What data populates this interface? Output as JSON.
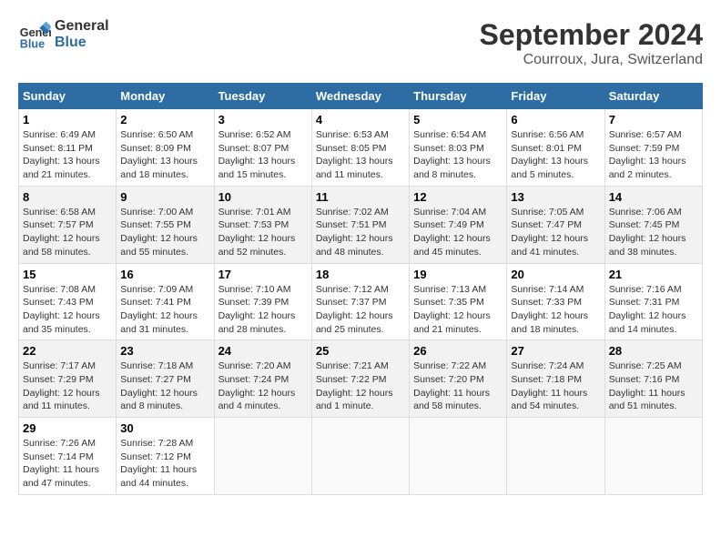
{
  "header": {
    "logo_line1": "General",
    "logo_line2": "Blue",
    "title": "September 2024",
    "subtitle": "Courroux, Jura, Switzerland"
  },
  "days_of_week": [
    "Sunday",
    "Monday",
    "Tuesday",
    "Wednesday",
    "Thursday",
    "Friday",
    "Saturday"
  ],
  "weeks": [
    [
      {
        "day": "1",
        "info": "Sunrise: 6:49 AM\nSunset: 8:11 PM\nDaylight: 13 hours\nand 21 minutes."
      },
      {
        "day": "2",
        "info": "Sunrise: 6:50 AM\nSunset: 8:09 PM\nDaylight: 13 hours\nand 18 minutes."
      },
      {
        "day": "3",
        "info": "Sunrise: 6:52 AM\nSunset: 8:07 PM\nDaylight: 13 hours\nand 15 minutes."
      },
      {
        "day": "4",
        "info": "Sunrise: 6:53 AM\nSunset: 8:05 PM\nDaylight: 13 hours\nand 11 minutes."
      },
      {
        "day": "5",
        "info": "Sunrise: 6:54 AM\nSunset: 8:03 PM\nDaylight: 13 hours\nand 8 minutes."
      },
      {
        "day": "6",
        "info": "Sunrise: 6:56 AM\nSunset: 8:01 PM\nDaylight: 13 hours\nand 5 minutes."
      },
      {
        "day": "7",
        "info": "Sunrise: 6:57 AM\nSunset: 7:59 PM\nDaylight: 13 hours\nand 2 minutes."
      }
    ],
    [
      {
        "day": "8",
        "info": "Sunrise: 6:58 AM\nSunset: 7:57 PM\nDaylight: 12 hours\nand 58 minutes."
      },
      {
        "day": "9",
        "info": "Sunrise: 7:00 AM\nSunset: 7:55 PM\nDaylight: 12 hours\nand 55 minutes."
      },
      {
        "day": "10",
        "info": "Sunrise: 7:01 AM\nSunset: 7:53 PM\nDaylight: 12 hours\nand 52 minutes."
      },
      {
        "day": "11",
        "info": "Sunrise: 7:02 AM\nSunset: 7:51 PM\nDaylight: 12 hours\nand 48 minutes."
      },
      {
        "day": "12",
        "info": "Sunrise: 7:04 AM\nSunset: 7:49 PM\nDaylight: 12 hours\nand 45 minutes."
      },
      {
        "day": "13",
        "info": "Sunrise: 7:05 AM\nSunset: 7:47 PM\nDaylight: 12 hours\nand 41 minutes."
      },
      {
        "day": "14",
        "info": "Sunrise: 7:06 AM\nSunset: 7:45 PM\nDaylight: 12 hours\nand 38 minutes."
      }
    ],
    [
      {
        "day": "15",
        "info": "Sunrise: 7:08 AM\nSunset: 7:43 PM\nDaylight: 12 hours\nand 35 minutes."
      },
      {
        "day": "16",
        "info": "Sunrise: 7:09 AM\nSunset: 7:41 PM\nDaylight: 12 hours\nand 31 minutes."
      },
      {
        "day": "17",
        "info": "Sunrise: 7:10 AM\nSunset: 7:39 PM\nDaylight: 12 hours\nand 28 minutes."
      },
      {
        "day": "18",
        "info": "Sunrise: 7:12 AM\nSunset: 7:37 PM\nDaylight: 12 hours\nand 25 minutes."
      },
      {
        "day": "19",
        "info": "Sunrise: 7:13 AM\nSunset: 7:35 PM\nDaylight: 12 hours\nand 21 minutes."
      },
      {
        "day": "20",
        "info": "Sunrise: 7:14 AM\nSunset: 7:33 PM\nDaylight: 12 hours\nand 18 minutes."
      },
      {
        "day": "21",
        "info": "Sunrise: 7:16 AM\nSunset: 7:31 PM\nDaylight: 12 hours\nand 14 minutes."
      }
    ],
    [
      {
        "day": "22",
        "info": "Sunrise: 7:17 AM\nSunset: 7:29 PM\nDaylight: 12 hours\nand 11 minutes."
      },
      {
        "day": "23",
        "info": "Sunrise: 7:18 AM\nSunset: 7:27 PM\nDaylight: 12 hours\nand 8 minutes."
      },
      {
        "day": "24",
        "info": "Sunrise: 7:20 AM\nSunset: 7:24 PM\nDaylight: 12 hours\nand 4 minutes."
      },
      {
        "day": "25",
        "info": "Sunrise: 7:21 AM\nSunset: 7:22 PM\nDaylight: 12 hours\nand 1 minute."
      },
      {
        "day": "26",
        "info": "Sunrise: 7:22 AM\nSunset: 7:20 PM\nDaylight: 11 hours\nand 58 minutes."
      },
      {
        "day": "27",
        "info": "Sunrise: 7:24 AM\nSunset: 7:18 PM\nDaylight: 11 hours\nand 54 minutes."
      },
      {
        "day": "28",
        "info": "Sunrise: 7:25 AM\nSunset: 7:16 PM\nDaylight: 11 hours\nand 51 minutes."
      }
    ],
    [
      {
        "day": "29",
        "info": "Sunrise: 7:26 AM\nSunset: 7:14 PM\nDaylight: 11 hours\nand 47 minutes."
      },
      {
        "day": "30",
        "info": "Sunrise: 7:28 AM\nSunset: 7:12 PM\nDaylight: 11 hours\nand 44 minutes."
      },
      {
        "day": "",
        "info": ""
      },
      {
        "day": "",
        "info": ""
      },
      {
        "day": "",
        "info": ""
      },
      {
        "day": "",
        "info": ""
      },
      {
        "day": "",
        "info": ""
      }
    ]
  ]
}
